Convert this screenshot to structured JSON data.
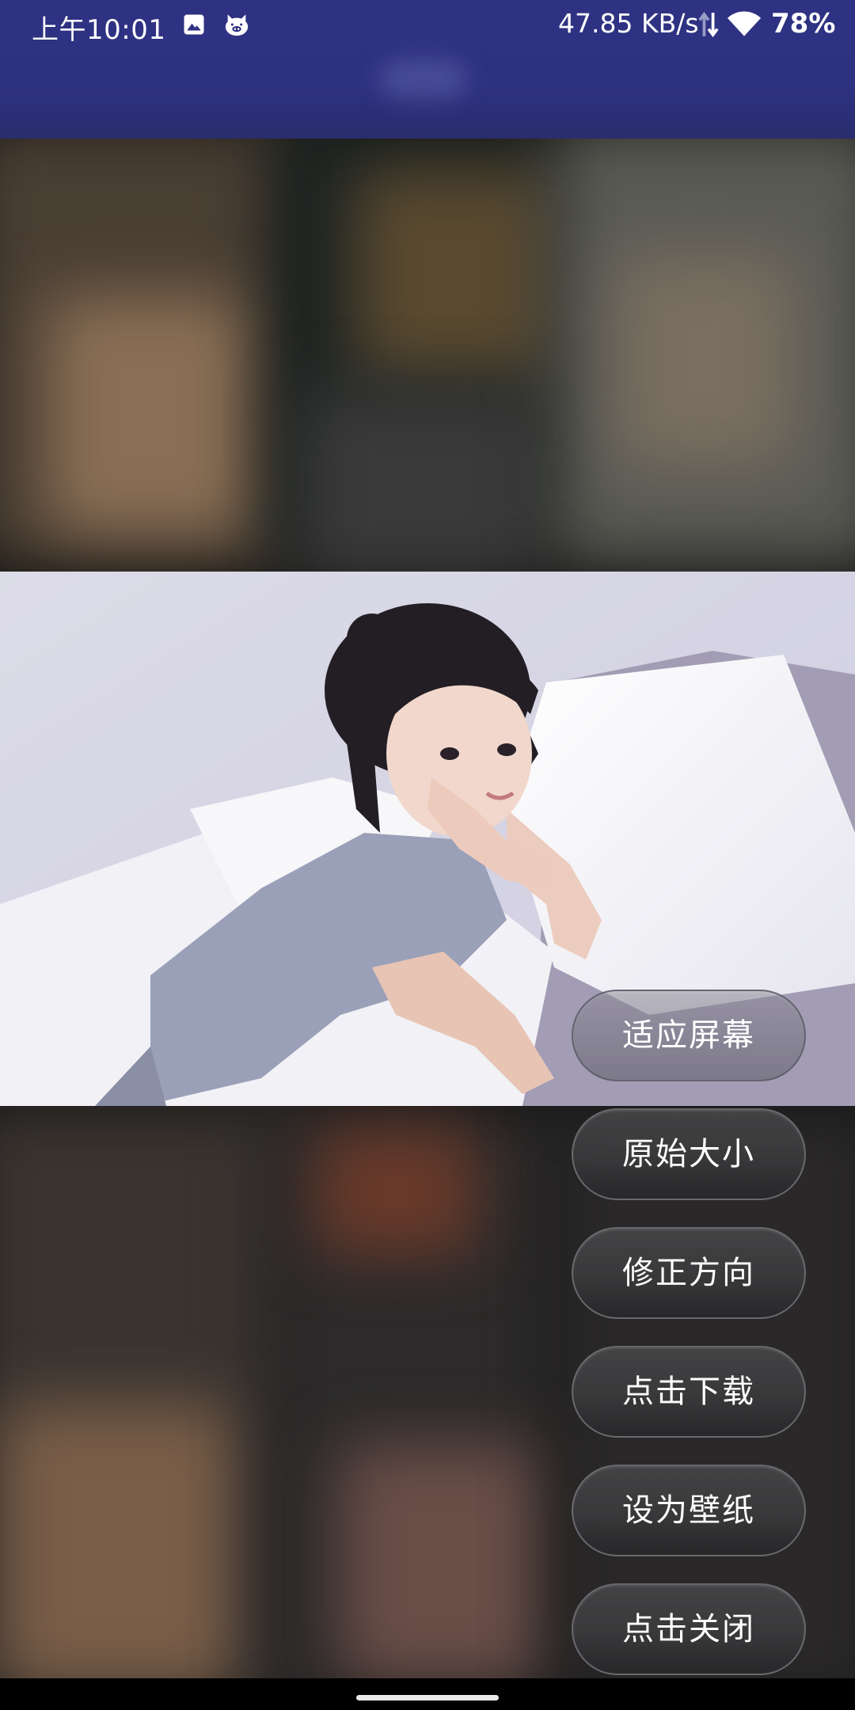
{
  "status_bar": {
    "time": "上午10:01",
    "network_speed": "47.85 KB/s",
    "battery": "78%",
    "icons": [
      "image-icon",
      "pig-icon",
      "data-updown-icon",
      "wifi-icon"
    ]
  },
  "photo": {
    "description_icon": "photo-preview"
  },
  "menu": {
    "items": [
      {
        "label": "适应屏幕"
      },
      {
        "label": "原始大小"
      },
      {
        "label": "修正方向"
      },
      {
        "label": "点击下载"
      },
      {
        "label": "设为壁纸"
      },
      {
        "label": "点击关闭"
      }
    ]
  },
  "colors": {
    "app_bar": "#2f3283",
    "menu_button": "#3a3a3c",
    "menu_text": "#ffffff"
  }
}
